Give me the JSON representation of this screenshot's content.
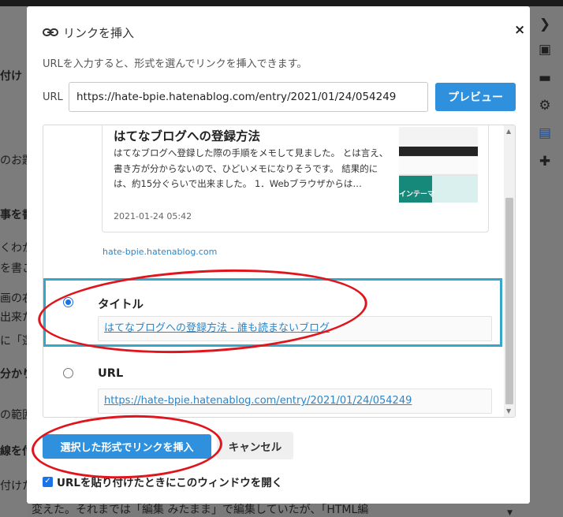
{
  "background": {
    "left_fragments": [
      "付け",
      "のお題",
      "事を書",
      "くわか",
      "を書こ",
      "画の右",
      "出来た",
      "に「選",
      "分かり",
      "の範囲",
      "線を付",
      "付けた"
    ],
    "bottom_text": "変えた。それまでは「編集 みたまま」で編集していたが、「HTML編",
    "right_icons": [
      "chevron-right-icon",
      "image-icon",
      "folder-icon",
      "gear-icon",
      "document-icon",
      "plus-icon"
    ]
  },
  "dialog": {
    "title": "リンクを挿入",
    "close_label": "×",
    "description": "URLを入力すると、形式を選んでリンクを挿入できます。",
    "url_label": "URL",
    "url_value": "https://hate-bpie.hatenablog.com/entry/2021/01/24/054249",
    "preview_button": "プレビュー",
    "embed_card": {
      "title": "はてなブログへの登録方法",
      "description": "はてなブログへ登録した際の手順をメモして見ました。 とは言え、書き方が分からないので、ひどいメモになりそうです。 結果的には、約15分ぐらいで出来ました。 1．Webブラウザからは…",
      "date": "2021-01-24 05:42",
      "domain": "hate-bpie.hatenablog.com",
      "thumbnail_label": "インテーマ"
    },
    "options": [
      {
        "label": "タイトル",
        "value": "はてなブログへの登録方法 - 誰も読まないブログ",
        "selected": true
      },
      {
        "label": "URL",
        "value": "https://hate-bpie.hatenablog.com/entry/2021/01/24/054249",
        "selected": false
      }
    ],
    "insert_button": "選択した形式でリンクを挿入",
    "cancel_button": "キャンセル",
    "checkbox_label": "URLを貼り付けたときにこのウィンドウを開く",
    "checkbox_checked": true
  },
  "colors": {
    "accent": "#2f91dd",
    "highlight_border": "#36a7c9",
    "annotation_red": "#e0141c",
    "overlay": "#6e6e6e"
  }
}
